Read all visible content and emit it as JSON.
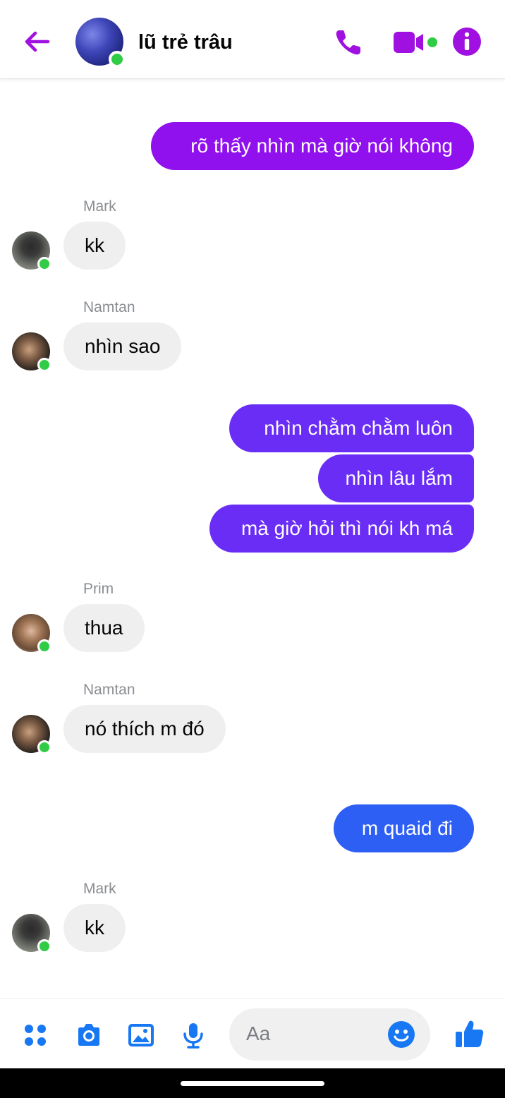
{
  "header": {
    "title": "lũ trẻ trâu",
    "icons": {
      "back": "back-arrow-icon",
      "call": "phone-icon",
      "video": "video-camera-icon",
      "info": "info-icon"
    },
    "accent_color": "#a010e0"
  },
  "messages": {
    "m1": {
      "text": "rõ thấy nhìn mà giờ nói không"
    },
    "m2": {
      "sender": "Mark",
      "text": "kk"
    },
    "m3": {
      "sender": "Namtan",
      "text": "nhìn sao"
    },
    "m4": {
      "text": "nhìn chằm chằm luôn"
    },
    "m5": {
      "text": "nhìn lâu lắm"
    },
    "m6": {
      "text": "mà giờ hỏi thì nói kh má"
    },
    "m7": {
      "sender": "Prim",
      "text": "thua"
    },
    "m8": {
      "sender": "Namtan",
      "text": "nó thích m đó"
    },
    "m9": {
      "text": "m quaid đi"
    },
    "m10": {
      "sender": "Mark",
      "text": "kk"
    }
  },
  "composer": {
    "placeholder": "Aa",
    "icons": [
      "apps-icon",
      "camera-icon",
      "gallery-icon",
      "microphone-icon",
      "emoji-icon",
      "thumbs-up-icon"
    ],
    "accent_color": "#1877f2"
  },
  "colors": {
    "outgoing_purple": "#9010ee",
    "outgoing_violet": "#6a2df6",
    "outgoing_blue": "#2e5ff5",
    "incoming_bg": "#efefef",
    "online": "#31cc46"
  }
}
